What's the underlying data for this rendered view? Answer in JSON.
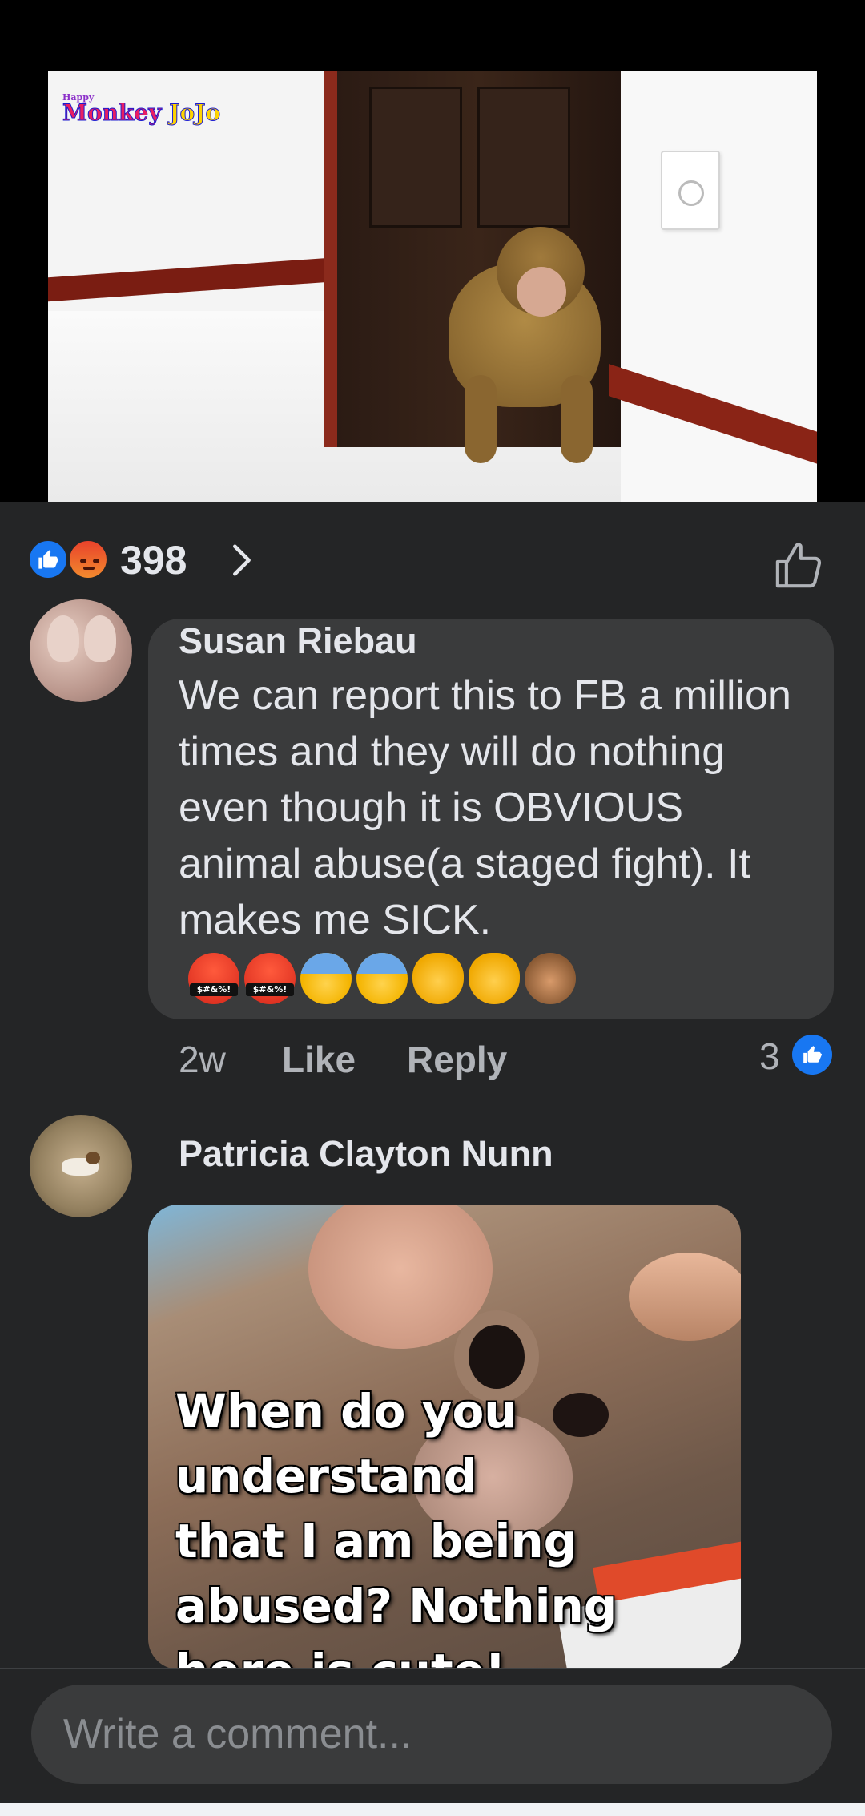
{
  "video": {
    "logo_small": "Happy",
    "logo_word1": "Monkey",
    "logo_word2": "JoJo"
  },
  "reactions": {
    "count": "398",
    "types": [
      "like",
      "angry"
    ],
    "like_icon": "thumbs-up-icon",
    "angry_icon": "angry-face-icon"
  },
  "comments": [
    {
      "author": "Susan Riebau",
      "text": "We can report this to FB a million times and they will do nothing even though it is OBVIOUS animal abuse(a staged fight). It makes me SICK.",
      "cuss_symbol": "$#&%!",
      "emojis": [
        "face-with-symbols-on-mouth",
        "face-with-symbols-on-mouth",
        "anxious-face-with-sweat",
        "anxious-face-with-sweat",
        "crying-cat-face",
        "crying-cat-face",
        "see-no-evil-monkey"
      ],
      "time": "2w",
      "like_label": "Like",
      "reply_label": "Reply",
      "like_count": "3"
    },
    {
      "author": "Patricia Clayton Nunn",
      "image_text": "When do you\nunderstand\nthat I am being\nabused? Nothing\nhere is cute!"
    }
  ],
  "composer": {
    "placeholder": "Write a comment..."
  },
  "colors": {
    "background": "#242526",
    "bubble": "#3a3b3c",
    "accent_blue": "#1877f2",
    "secondary_text": "#b0b3b8"
  }
}
